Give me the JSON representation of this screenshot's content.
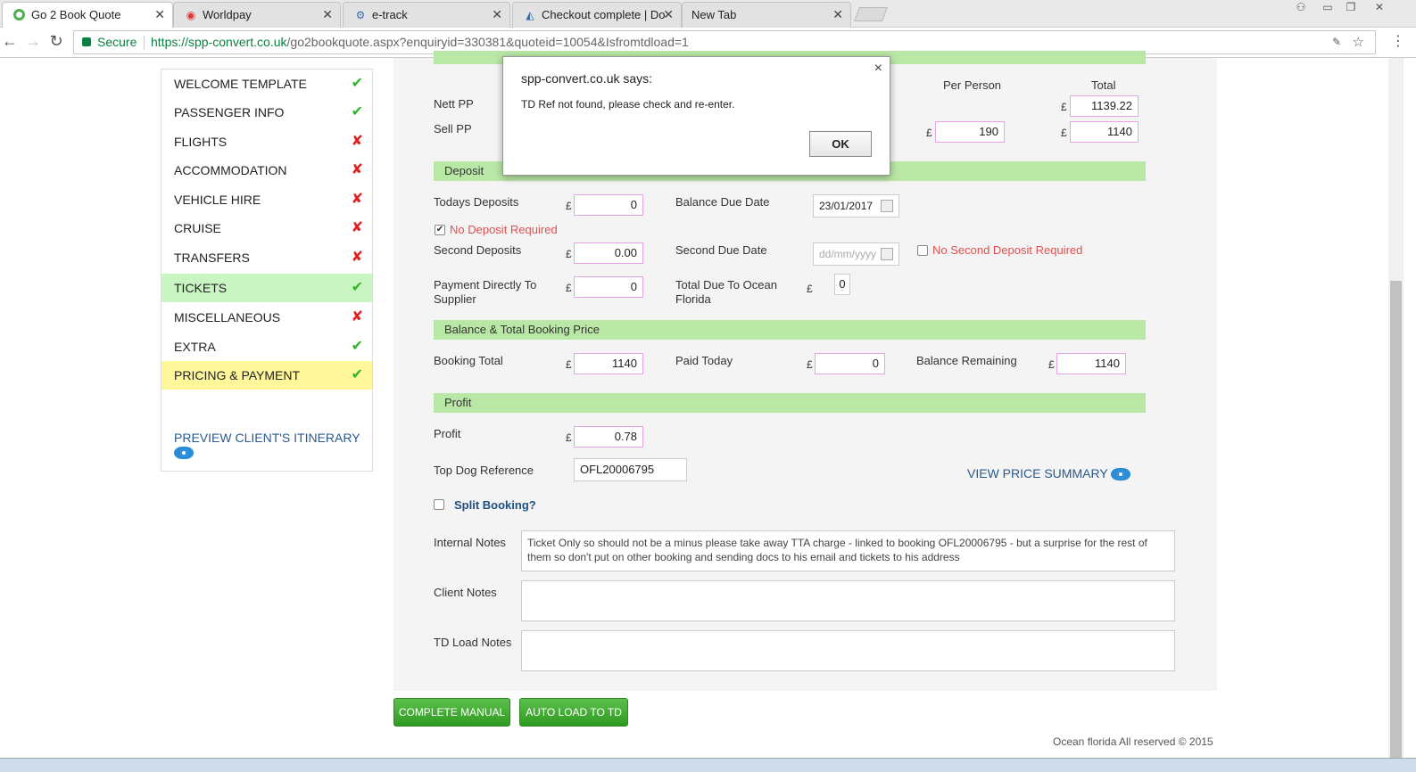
{
  "browser": {
    "tabs": [
      {
        "title": "Go 2 Book Quote",
        "active": true
      },
      {
        "title": "Worldpay"
      },
      {
        "title": "e-track"
      },
      {
        "title": "Checkout complete | Do"
      },
      {
        "title": "New Tab"
      }
    ],
    "secure_label": "Secure",
    "url_base": "https://spp-convert.co.uk",
    "url_path": "/go2bookquote.aspx?enquiryid=330381&quoteid=10054&Isfromtdload=1"
  },
  "sidebar": {
    "items": [
      {
        "label": "WELCOME TEMPLATE",
        "status": "✔"
      },
      {
        "label": "PASSENGER INFO",
        "status": "✔"
      },
      {
        "label": "FLIGHTS",
        "status": "✘"
      },
      {
        "label": "ACCOMMODATION",
        "status": "✘"
      },
      {
        "label": "VEHICLE HIRE",
        "status": "✘"
      },
      {
        "label": "CRUISE",
        "status": "✘"
      },
      {
        "label": "TRANSFERS",
        "status": "✘"
      },
      {
        "label": "TICKETS",
        "status": "✔"
      },
      {
        "label": "MISCELLANEOUS",
        "status": "✘"
      },
      {
        "label": "EXTRA",
        "status": "✔"
      },
      {
        "label": "PRICING & PAYMENT",
        "status": "✔"
      }
    ],
    "preview": "PREVIEW CLIENT'S ITINERARY"
  },
  "pricing": {
    "col_per_person": "Per Person",
    "col_total": "Total",
    "nett_label": "Nett PP",
    "sell_label": "Sell PP",
    "currency": "£",
    "nett_total": "1139.22",
    "sell_pp": "190",
    "sell_total": "1140"
  },
  "deposit": {
    "heading": "Deposit",
    "todays_label": "Todays Deposits",
    "todays_value": "0",
    "balance_due_label": "Balance Due Date",
    "balance_due_value": "23/01/2017",
    "no_deposit_label": "No Deposit Required",
    "second_label": "Second Deposits",
    "second_value": "0.00",
    "second_due_label": "Second Due Date",
    "second_due_placeholder": "dd/mm/yyyy",
    "no_second_label": "No Second Deposit Required",
    "direct_label_1": "Payment Directly To",
    "direct_label_2": "Supplier",
    "direct_value": "0",
    "total_due_label_1": "Total Due To Ocean",
    "total_due_label_2": "Florida",
    "total_due_value": "0"
  },
  "balance": {
    "heading": "Balance & Total Booking Price",
    "booking_total_label": "Booking Total",
    "booking_total_value": "1140",
    "paid_today_label": "Paid Today",
    "paid_today_value": "0",
    "remaining_label": "Balance Remaining",
    "remaining_value": "1140"
  },
  "profit": {
    "heading": "Profit",
    "profit_label": "Profit",
    "profit_value": "0.78",
    "td_ref_label": "Top Dog Reference",
    "td_ref_value": "OFL20006795",
    "view_summary": "VIEW PRICE SUMMARY",
    "split_label": "Split Booking?"
  },
  "notes": {
    "internal_label": "Internal Notes",
    "internal_value": "Ticket Only so should not be a minus please take away TTA charge  - linked to booking OFL20006795 - but a surprise for the rest of them so don't put on other booking and sending docs to his email and tickets to his address",
    "client_label": "Client Notes",
    "td_load_label": "TD Load Notes"
  },
  "actions": {
    "complete_manual": "COMPLETE MANUAL",
    "auto_load": "AUTO LOAD TO TD"
  },
  "footer": "Ocean florida All reserved © 2015",
  "dialog": {
    "title": "spp-convert.co.uk says:",
    "message": "TD Ref not found, please check and re-enter.",
    "ok": "OK",
    "close": "×"
  }
}
